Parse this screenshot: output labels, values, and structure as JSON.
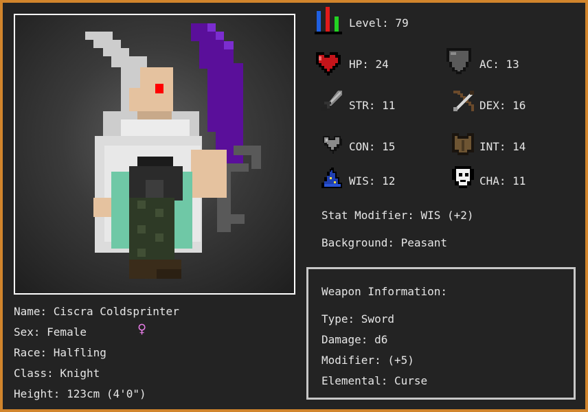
{
  "character": {
    "name": "Name: Ciscra Coldsprinter",
    "sex": "Sex: Female",
    "sex_symbol": "♀",
    "race": "Race: Halfling",
    "class": "Class: Knight",
    "height": "Height: 123cm (4'0\")"
  },
  "stats": {
    "level": "Level: 79",
    "hp": "HP: 24",
    "ac": "AC: 13",
    "str": "STR: 11",
    "dex": "DEX: 16",
    "con": "CON: 15",
    "int": "INT: 14",
    "wis": "WIS: 12",
    "cha": "CHA: 11",
    "modifier": "Stat Modifier: WIS (+2)",
    "background": "Background: Peasant"
  },
  "weapon": {
    "title": "Weapon Information:",
    "type": "Type: Sword",
    "damage": "Damage: d6",
    "modifier": "Modifier: (+5)",
    "elemental": "Elemental: Curse"
  },
  "icons": {
    "level": "level-bars-icon",
    "hp": "heart-icon",
    "ac": "shield-icon",
    "str": "sword-icon",
    "dex": "bow-icon",
    "con": "grey-heart-icon",
    "int": "armor-icon",
    "wis": "wizard-hat-icon",
    "cha": "mask-icon",
    "sex": "female-symbol-icon"
  },
  "colors": {
    "frame": "#d1852c",
    "panel": "#232323",
    "text": "#e6e6e6",
    "sex_symbol": "#e77ce6"
  }
}
